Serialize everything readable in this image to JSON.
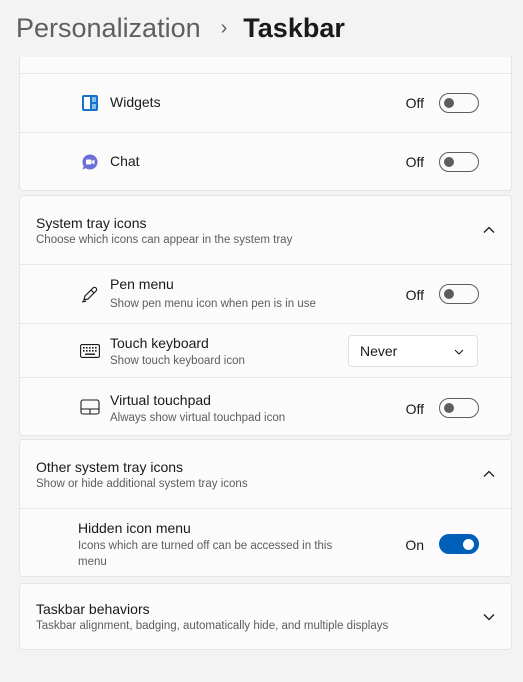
{
  "breadcrumb": {
    "parent": "Personalization",
    "separator": "›",
    "current": "Taskbar"
  },
  "taskbar_items": [
    {
      "label": "Widgets",
      "state": "Off",
      "on": false,
      "icon": "widgets-icon"
    },
    {
      "label": "Chat",
      "state": "Off",
      "on": false,
      "icon": "chat-icon"
    }
  ],
  "system_tray": {
    "title": "System tray icons",
    "subtitle": "Choose which icons can appear in the system tray",
    "expanded": true,
    "items": {
      "pen_menu": {
        "label": "Pen menu",
        "desc": "Show pen menu icon when pen is in use",
        "state": "Off",
        "icon": "pen-icon"
      },
      "touch_keyboard": {
        "label": "Touch keyboard",
        "desc": "Show touch keyboard icon",
        "value": "Never",
        "icon": "keyboard-icon"
      },
      "virtual_touchpad": {
        "label": "Virtual touchpad",
        "desc": "Always show virtual touchpad icon",
        "state": "Off",
        "icon": "touchpad-icon"
      }
    }
  },
  "other_tray": {
    "title": "Other system tray icons",
    "subtitle": "Show or hide additional system tray icons",
    "expanded": true,
    "hidden_menu": {
      "label": "Hidden icon menu",
      "desc_line1": "Icons which are turned off can be accessed in this",
      "desc_line2": "menu",
      "state": "On"
    }
  },
  "behaviors": {
    "title": "Taskbar behaviors",
    "subtitle": "Taskbar alignment, badging, automatically hide, and multiple displays",
    "expanded": false
  },
  "colors": {
    "accent": "#005fb8",
    "background": "#f3f3f3",
    "card": "#fbfbfb"
  }
}
